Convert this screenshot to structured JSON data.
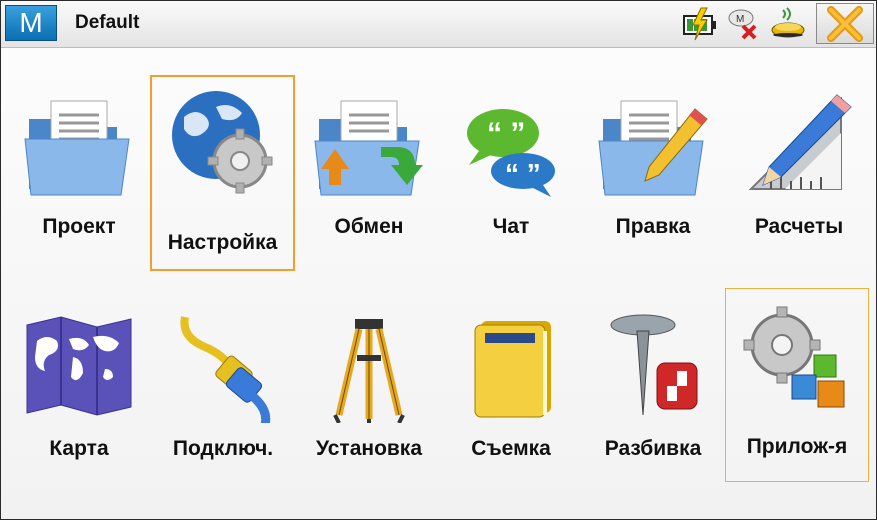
{
  "header": {
    "logo_letter": "M",
    "title": "Default",
    "status_icons": [
      "battery-charging-icon",
      "cloud-disconnected-icon",
      "gnss-receiver-icon"
    ],
    "close_icon": "close-x-icon",
    "accent": "#f0a030"
  },
  "menu": {
    "items": [
      {
        "label": "Проект",
        "icon": "project-folder-icon",
        "selected": false
      },
      {
        "label": "Настройка",
        "icon": "settings-globe-gear-icon",
        "selected": true
      },
      {
        "label": "Обмен",
        "icon": "exchange-folder-arrows-icon",
        "selected": false
      },
      {
        "label": "Чат",
        "icon": "chat-bubbles-icon",
        "selected": false
      },
      {
        "label": "Правка",
        "icon": "edit-folder-pencil-icon",
        "selected": false
      },
      {
        "label": "Расчеты",
        "icon": "calculations-ruler-pencil-icon",
        "selected": false
      },
      {
        "label": "Карта",
        "icon": "map-icon",
        "selected": false
      },
      {
        "label": "Подключ.",
        "icon": "connect-cable-icon",
        "selected": false
      },
      {
        "label": "Установка",
        "icon": "tripod-icon",
        "selected": false
      },
      {
        "label": "Съемка",
        "icon": "survey-book-icon",
        "selected": false
      },
      {
        "label": "Разбивка",
        "icon": "stakeout-pin-icon",
        "selected": false
      },
      {
        "label": "Прилож-я",
        "icon": "applications-gear-blocks-icon",
        "selected": true
      }
    ]
  }
}
